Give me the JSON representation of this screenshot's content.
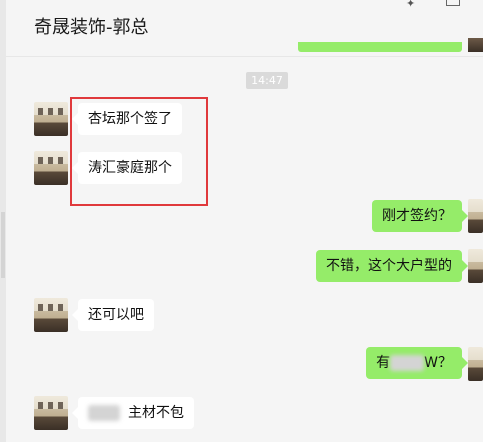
{
  "header": {
    "title": "奇晟装饰-郭总",
    "pin_icon": "pin-icon",
    "window_icon": "window-restore-icon"
  },
  "timestamp": "14:47",
  "messages": [
    {
      "side": "in",
      "text": "杏坛那个签了"
    },
    {
      "side": "in",
      "text": "涛汇豪庭那个"
    },
    {
      "side": "out",
      "text": "刚才签约？"
    },
    {
      "side": "out",
      "text": "不错，这个大户型的"
    },
    {
      "side": "in",
      "text": "还可以吧"
    },
    {
      "side": "out",
      "prefix": "有",
      "suffix": "W？"
    },
    {
      "side": "in",
      "prefix": "",
      "suffix": "主材不包"
    }
  ],
  "colors": {
    "incoming_bubble": "#ffffff",
    "outgoing_bubble": "#95ec69",
    "background": "#f5f5f5",
    "highlight_border": "#e0393c"
  }
}
